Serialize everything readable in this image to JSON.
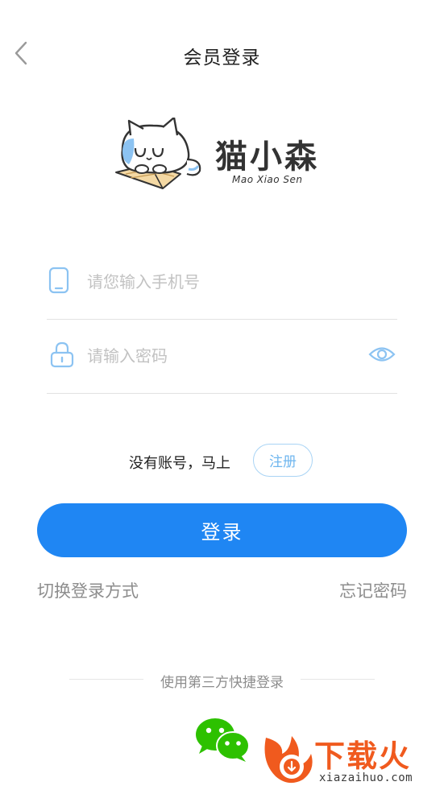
{
  "header": {
    "title": "会员登录",
    "back_icon": "chevron-left-icon"
  },
  "logo": {
    "title": "猫小森",
    "subtitle": "Mao Xiao Sen"
  },
  "form": {
    "phone": {
      "placeholder": "请您输入手机号",
      "value": "",
      "icon": "phone-icon"
    },
    "password": {
      "placeholder": "请输入密码",
      "value": "",
      "icon": "lock-icon",
      "toggle_icon": "eye-icon"
    }
  },
  "register": {
    "prompt": "没有账号，马上",
    "button_label": "注册"
  },
  "login_button": "登录",
  "links": {
    "switch_method": "切换登录方式",
    "forgot_password": "忘记密码"
  },
  "third_party": {
    "label": "使用第三方快捷登录",
    "wechat_icon": "wechat-icon"
  },
  "watermark": {
    "text": "下载火",
    "url": "xiazaihuo.com"
  },
  "colors": {
    "primary": "#1f86f3",
    "accent_light": "#6fb6ef",
    "icon_blue": "#8cc3f2",
    "muted_text": "#8d8d8d",
    "wechat_green": "#2dc100",
    "watermark_orange": "#f05a1e"
  }
}
